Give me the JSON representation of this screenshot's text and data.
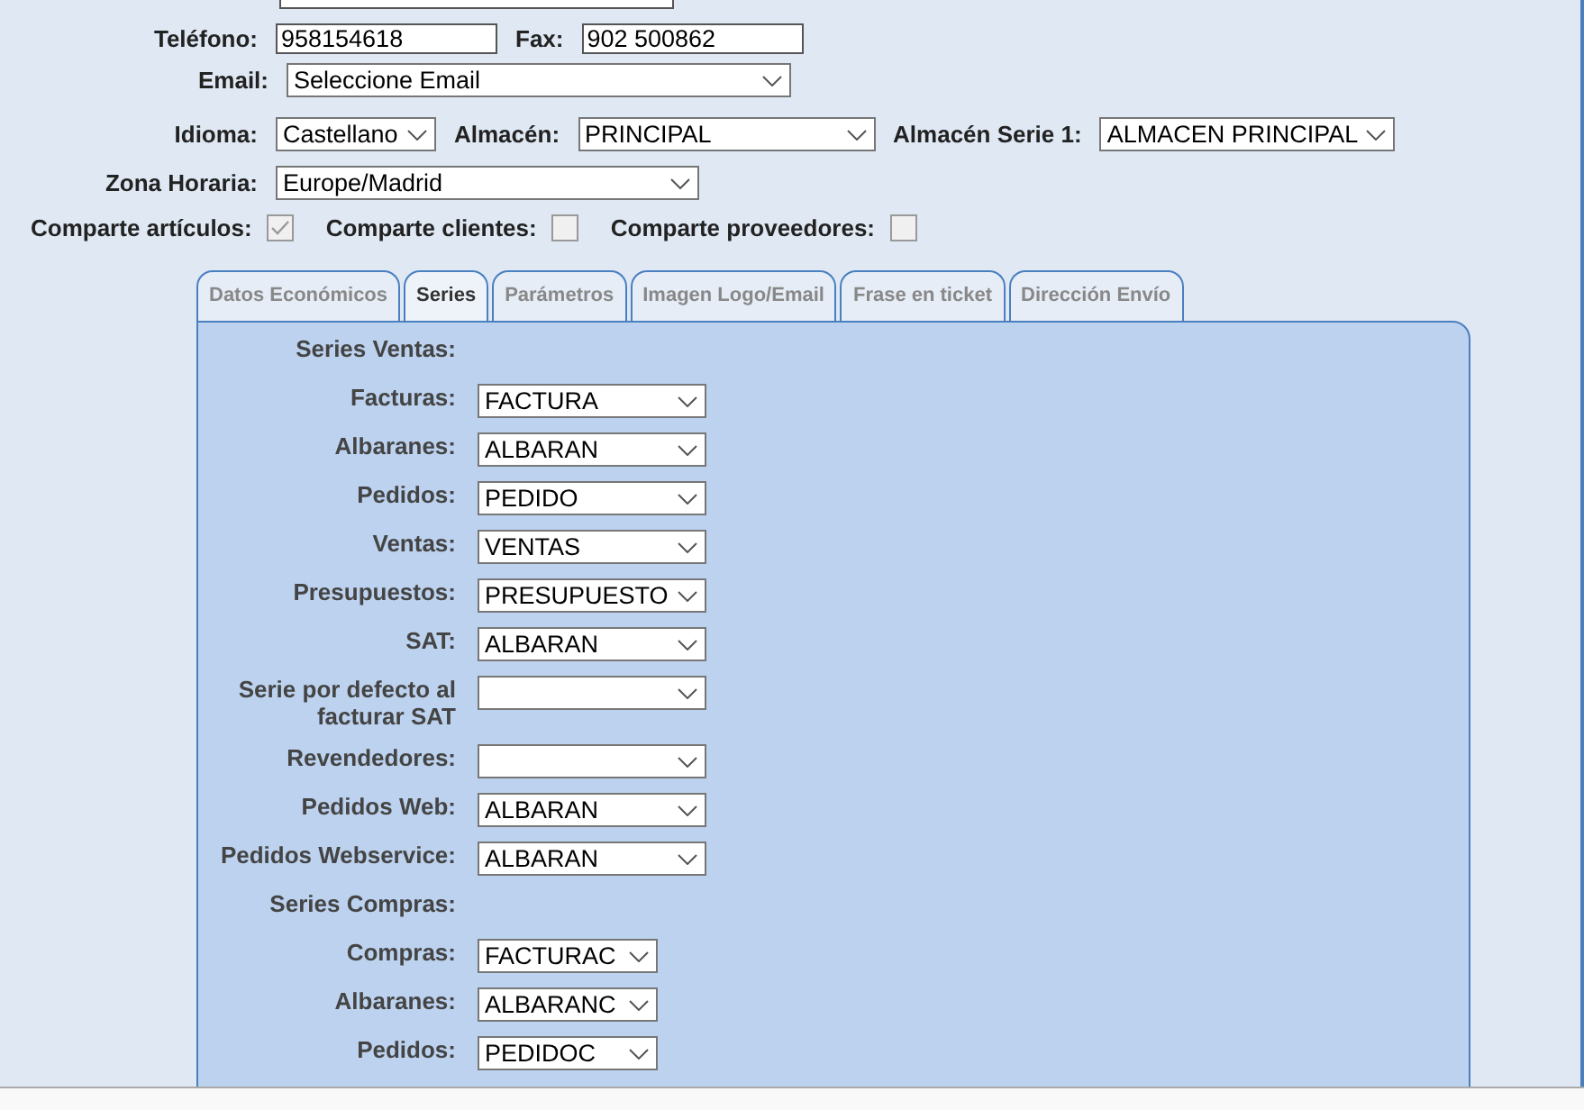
{
  "contact": {
    "phone_label": "Teléfono:",
    "phone": "958154618",
    "fax_label": "Fax:",
    "fax": "902 500862",
    "email_label": "Email:",
    "email": "Seleccione Email"
  },
  "settings": {
    "language_label": "Idioma:",
    "language": "Castellano",
    "warehouse_label": "Almacén:",
    "warehouse": "PRINCIPAL",
    "warehouse_series_label": "Almacén Serie 1:",
    "warehouse_series": "ALMACEN PRINCIPAL",
    "timezone_label": "Zona Horaria:",
    "timezone": "Europe/Madrid"
  },
  "sharing": [
    {
      "label": "Comparte artículos:",
      "checked": true
    },
    {
      "label": "Comparte clientes:",
      "checked": false
    },
    {
      "label": "Comparte proveedores:",
      "checked": false
    }
  ],
  "tabs": [
    {
      "label": "Datos Económicos",
      "selected": false
    },
    {
      "label": "Series",
      "selected": true
    },
    {
      "label": "Parámetros",
      "selected": false
    },
    {
      "label": "Imagen Logo/Email",
      "selected": false
    },
    {
      "label": "Frase en ticket",
      "selected": false
    },
    {
      "label": "Dirección Envío",
      "selected": false
    }
  ],
  "series_rows": [
    {
      "kind": "heading",
      "label": "Series Ventas:"
    },
    {
      "kind": "select",
      "label": "Facturas:",
      "value": "FACTURA"
    },
    {
      "kind": "select",
      "label": "Albaranes:",
      "value": "ALBARAN"
    },
    {
      "kind": "select",
      "label": "Pedidos:",
      "value": "PEDIDO"
    },
    {
      "kind": "select",
      "label": "Ventas:",
      "value": "VENTAS"
    },
    {
      "kind": "select",
      "label": "Presupuestos:",
      "value": "PRESUPUESTO"
    },
    {
      "kind": "select",
      "label": "SAT:",
      "value": "ALBARAN"
    },
    {
      "kind": "select",
      "label": "Serie por defecto al facturar SAT"
    },
    {
      "kind": "select",
      "label": "Revendedores:"
    },
    {
      "kind": "select",
      "label": "Pedidos Web:",
      "value": "ALBARAN"
    },
    {
      "kind": "select",
      "label": "Pedidos Webservice:",
      "value": "ALBARAN"
    },
    {
      "kind": "heading",
      "label": "Series Compras:"
    },
    {
      "kind": "short-select",
      "label": "Compras:",
      "value": "FACTURAC"
    },
    {
      "kind": "short-select",
      "label": "Albaranes:",
      "value": "ALBARANC"
    },
    {
      "kind": "short-select",
      "label": "Pedidos:",
      "value": "PEDIDOC"
    }
  ]
}
